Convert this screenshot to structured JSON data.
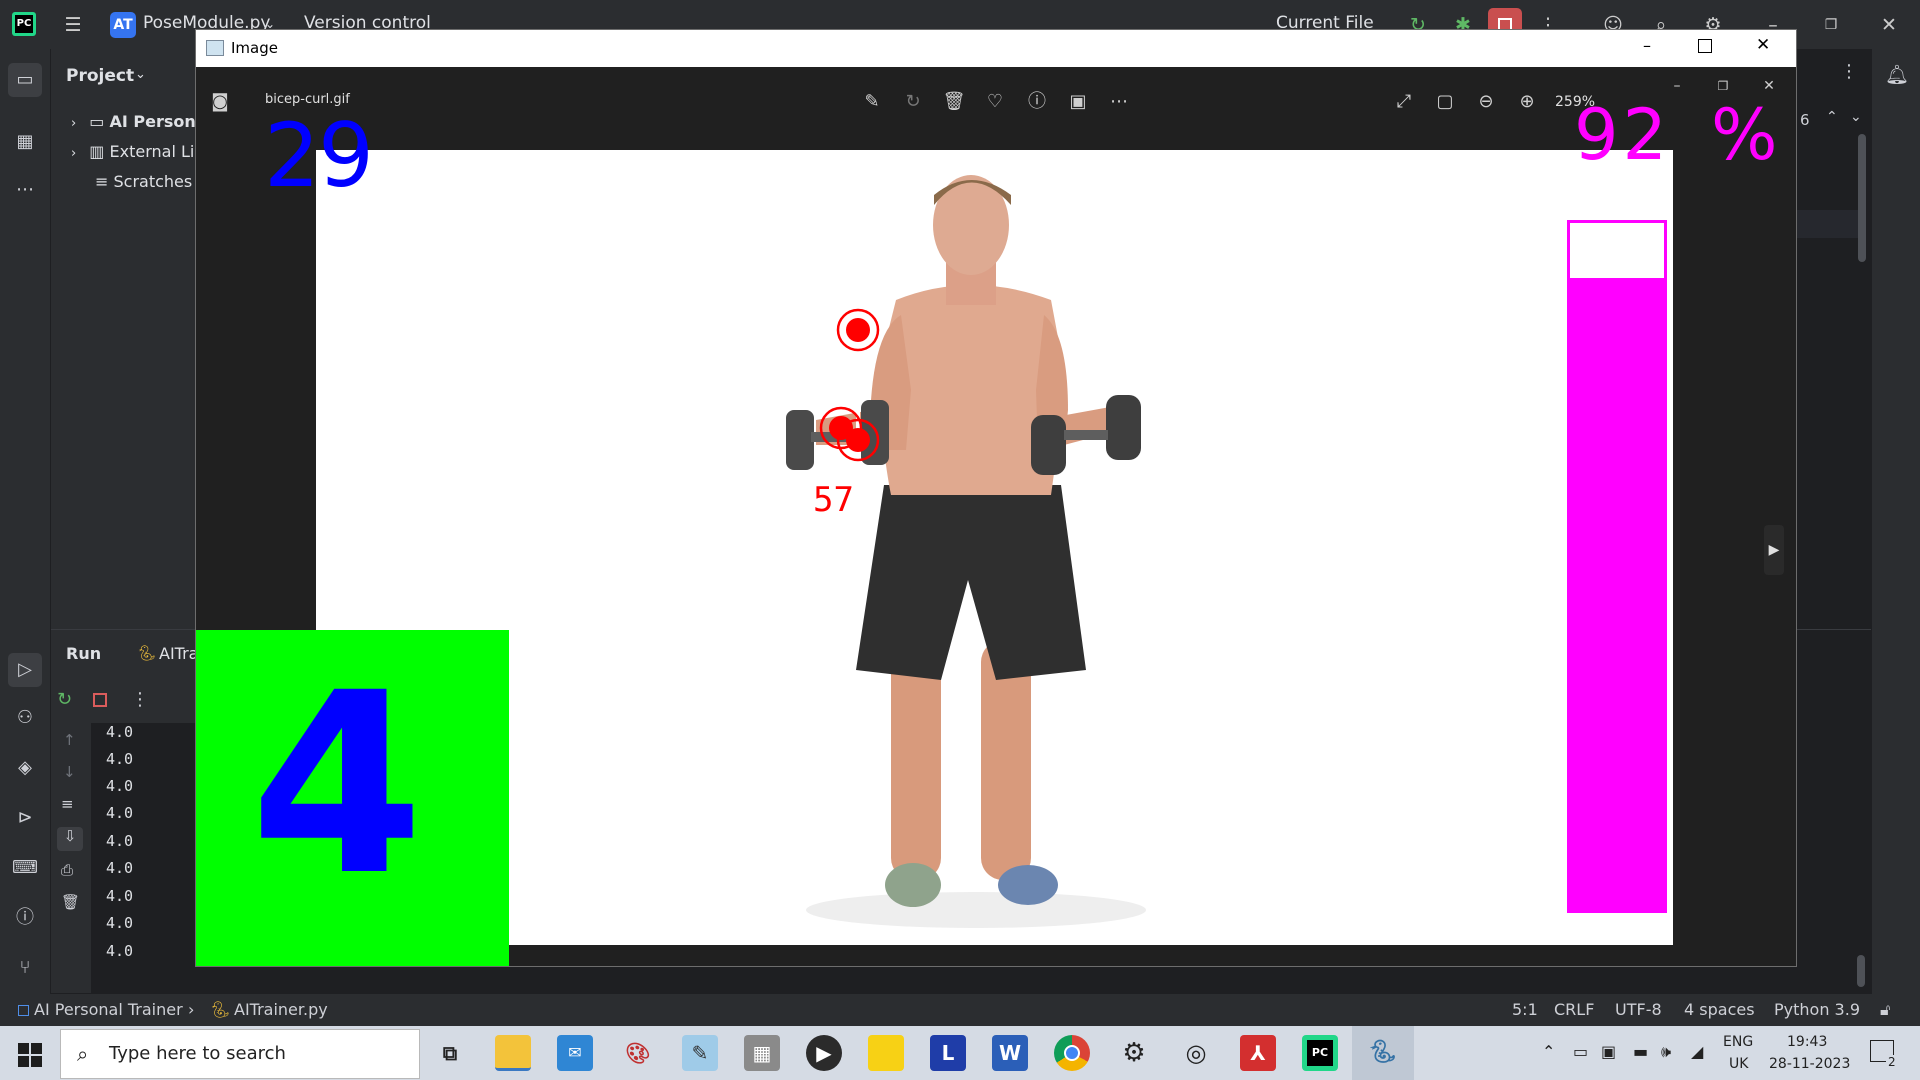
{
  "ide": {
    "project_badge": "AT",
    "file_name": "PoseModule.py",
    "version_control": "Version control",
    "run_config": "Current File"
  },
  "project_panel": {
    "title": "Project",
    "items": [
      {
        "label": "AI Person"
      },
      {
        "label": "External Li"
      },
      {
        "label": "Scratches"
      }
    ]
  },
  "run_panel": {
    "title": "Run",
    "tab_label": "AITra",
    "output_lines": [
      "4.0",
      "4.0",
      "4.0",
      "4.0",
      "4.0",
      "4.0",
      "4.0",
      "4.0",
      "4.0"
    ]
  },
  "editor_right": {
    "match_count": "6"
  },
  "image_window": {
    "title": "Image",
    "file_name": "bicep-curl.gif",
    "zoom": "259%",
    "overlay": {
      "fps": "29",
      "percent": "92",
      "percent_sign": "%",
      "angle": "57",
      "rep_count": "4",
      "progress_fraction": 0.92,
      "colors": {
        "fps": "#0000ff",
        "percent": "#ff00ff",
        "bar": "#ff00ff",
        "angle": "#ff0000",
        "count_bg": "#00ff00",
        "count_text": "#0000ff",
        "joints": "#ff0000"
      }
    }
  },
  "status_bar": {
    "breadcrumb_project": "AI Personal Trainer",
    "breadcrumb_file": "AITrainer.py",
    "position": "5:1",
    "line_ending": "CRLF",
    "encoding": "UTF-8",
    "indent": "4 spaces",
    "interpreter": "Python 3.9"
  },
  "taskbar": {
    "search_placeholder": "Type here to search",
    "language": "ENG",
    "region": "UK",
    "time": "19:43",
    "date": "28-11-2023",
    "notification_count": "2"
  }
}
